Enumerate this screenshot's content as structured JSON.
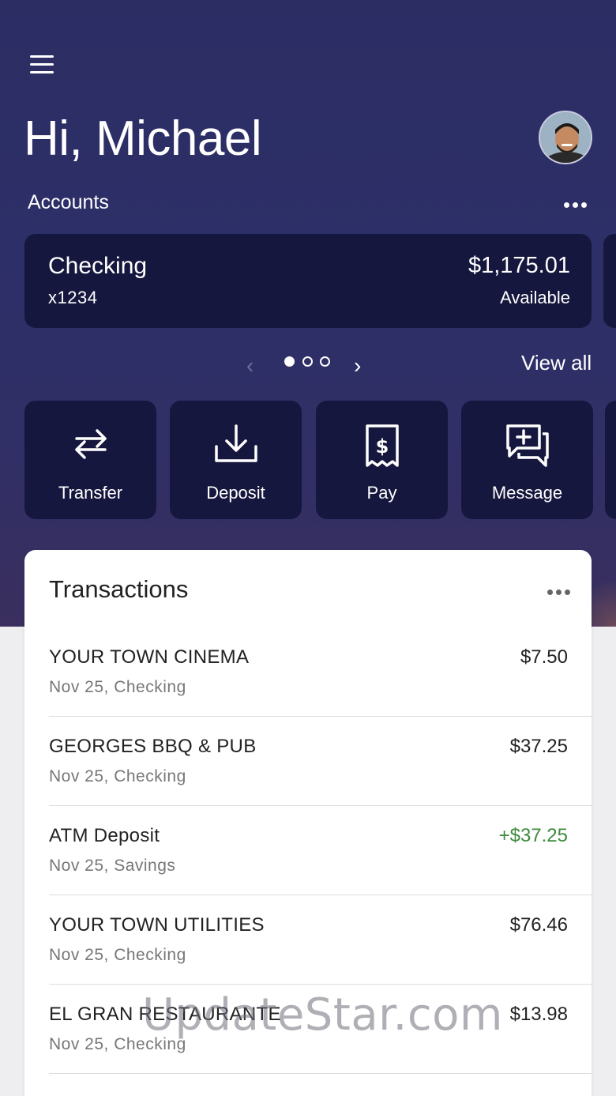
{
  "header": {
    "greeting": "Hi, Michael",
    "accounts_label": "Accounts"
  },
  "account_card": {
    "name": "Checking",
    "number": "x1234",
    "balance": "$1,175.01",
    "balance_label": "Available"
  },
  "pager": {
    "view_all": "View all"
  },
  "actions": [
    {
      "label": "Transfer",
      "icon": "transfer-icon"
    },
    {
      "label": "Deposit",
      "icon": "deposit-icon"
    },
    {
      "label": "Pay",
      "icon": "pay-icon"
    },
    {
      "label": "Message",
      "icon": "message-icon"
    }
  ],
  "transactions": {
    "title": "Transactions",
    "items": [
      {
        "merchant": "YOUR TOWN CINEMA",
        "meta": "Nov 25, Checking",
        "amount": "$7.50",
        "credit": false
      },
      {
        "merchant": "GEORGES BBQ & PUB",
        "meta": "Nov 25, Checking",
        "amount": "$37.25",
        "credit": false
      },
      {
        "merchant": "ATM Deposit",
        "meta": "Nov 25, Savings",
        "amount": "+$37.25",
        "credit": true
      },
      {
        "merchant": "YOUR TOWN UTILITIES",
        "meta": "Nov 25, Checking",
        "amount": "$76.46",
        "credit": false
      },
      {
        "merchant": "EL GRAN RESTAURANTE",
        "meta": "Nov 25, Checking",
        "amount": "$13.98",
        "credit": false
      }
    ]
  },
  "watermark": "UpdateStar.com",
  "colors": {
    "hero_bg": "#2d2f68",
    "card_bg": "#16173e",
    "credit_green": "#3d8b3d"
  }
}
